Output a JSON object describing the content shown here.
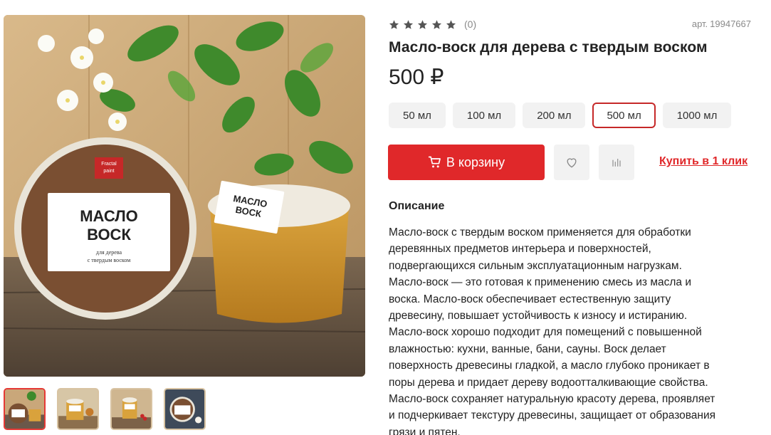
{
  "product": {
    "title": "Масло-воск для дерева с твердым воском",
    "price": "500 ₽",
    "sku_label": "арт.",
    "sku_value": "19947667",
    "rating_count": "(0)",
    "rating_value": 0,
    "rating_max": 5
  },
  "gallery": {
    "main_label_brand_line1": "Fractal",
    "main_label_brand_line2": "paint",
    "main_label_line1": "МАСЛО",
    "main_label_line2": "ВОСК",
    "main_label_sub1": "для дерева",
    "main_label_sub2": "с твердым воском",
    "small_label_line1": "МАСЛО",
    "small_label_line2": "ВОСК"
  },
  "volumes": [
    {
      "label": "50 мл",
      "selected": false
    },
    {
      "label": "100 мл",
      "selected": false
    },
    {
      "label": "200 мл",
      "selected": false
    },
    {
      "label": "500 мл",
      "selected": true
    },
    {
      "label": "1000 мл",
      "selected": false
    }
  ],
  "actions": {
    "cart_label": "В корзину",
    "one_click_label": "Купить в 1 клик"
  },
  "description": {
    "heading": "Описание",
    "lines": [
      "Масло-воск с твердым воском применяется для обработки",
      "деревянных предметов интерьера и поверхностей,",
      "подвергающихся сильным эксплуатационным нагрузкам.",
      "Масло-воск — это готовая к применению смесь из масла и",
      "воска. Масло-воск обеспечивает естественную защиту",
      "древесину, повышает устойчивость к износу и истиранию.",
      "Масло-воск хорошо подходит для помещений с повышенной",
      "влажностью: кухни, ванные, бани, сауны. Воск делает",
      "поверхность древесины гладкой, а масло глубоко проникает в",
      "поры дерева и придает дереву водоотталкивающие свойства.",
      "Масло-воск сохраняет натуральную красоту дерева, проявляет",
      "и подчеркивает текстуру древесины, защищает от образования",
      "грязи и пятен."
    ]
  },
  "colors": {
    "accent": "#e0282a",
    "selected_border": "#c62828",
    "star": "#555555"
  }
}
